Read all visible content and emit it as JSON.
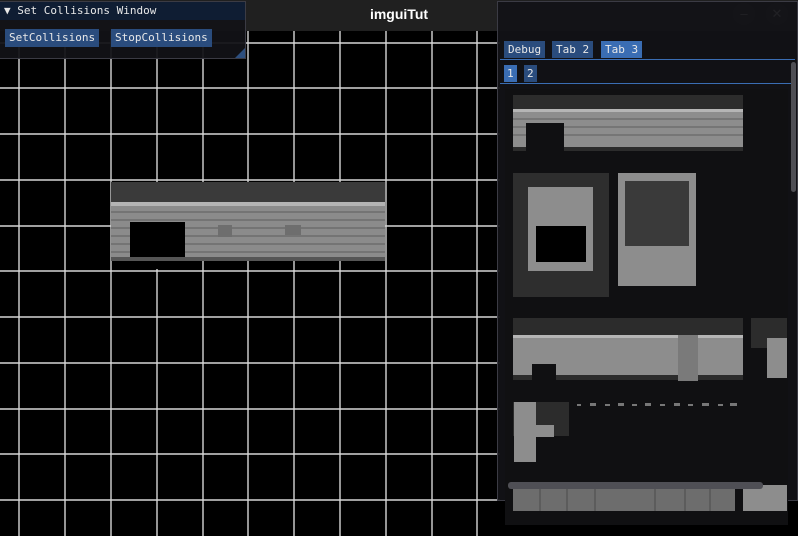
{
  "window": {
    "title": "imguiTut",
    "minimize_icon": "minimize-icon",
    "close_icon": "close-icon"
  },
  "collisions_window": {
    "title": "Set Collisions Window",
    "collapse_icon": "triangle-down-icon",
    "buttons": {
      "set": "SetCollisions",
      "stop": "StopCollisions"
    }
  },
  "tileset_window": {
    "tabs": [
      {
        "label": "Debug"
      },
      {
        "label": "Tab 2"
      },
      {
        "label": "Tab 3",
        "active": true
      }
    ],
    "subtabs": [
      {
        "label": "1",
        "active": true
      },
      {
        "label": "2"
      }
    ]
  },
  "colors": {
    "button": "#2a4c7d",
    "tab_active": "#3a6db3",
    "grid": "#d8d8d8",
    "brick": "#8d8d8d"
  }
}
